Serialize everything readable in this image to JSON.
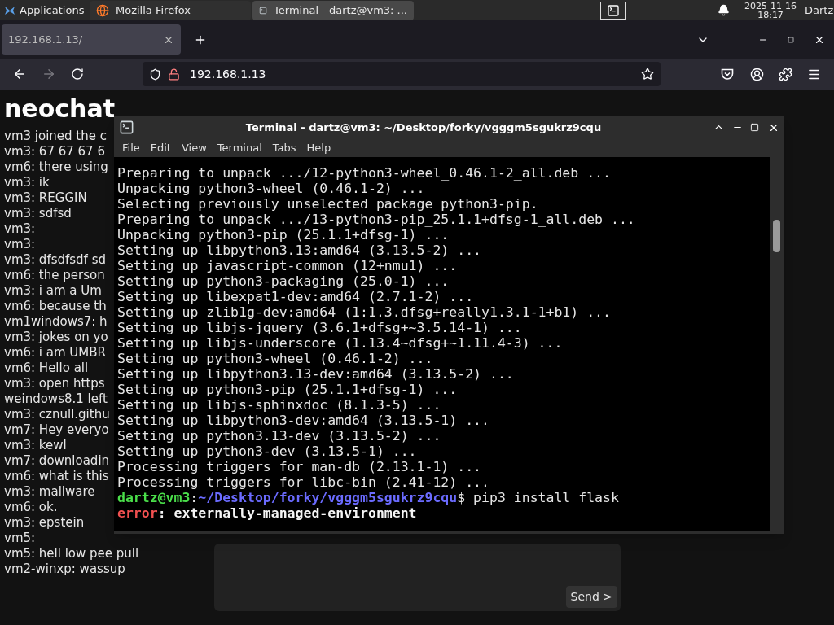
{
  "top_panel": {
    "menu_label": "Applications",
    "tasks": [
      {
        "label": "Mozilla Firefox",
        "kind": "browser",
        "selected": false
      },
      {
        "label": "Terminal - dartz@vm3: ...",
        "kind": "terminal",
        "selected": true
      }
    ],
    "date": "2025-11-16",
    "time": "18:17",
    "user": "Dartz"
  },
  "browser": {
    "tab": {
      "label": "192.168.1.13/"
    },
    "url": "192.168.1.13",
    "forward_disabled": true,
    "page": {
      "title": "neochat",
      "messages": [
        "vm3 joined the c",
        "vm3: 67 67 67 6",
        "vm6: there using",
        "vm3: ik",
        "vm3: REGGIN",
        "vm3: sdfsd",
        "vm3:",
        "vm3:",
        "vm3: dfsdfsdf sd",
        "vm6: the person",
        "vm3: i am a Um",
        "vm6: because th",
        "vm1windows7: h",
        "vm3: jokes on yo",
        "vm6: i am UMBR",
        "vm6: Hello all",
        "vm3: open https",
        "weindows8.1 left",
        "vm3: cznull.githu",
        "vm7: Hey everyo",
        "vm3: kewl",
        "vm7: downloadin",
        "vm6: what is this",
        "vm3: mallware",
        "vm6: ok.",
        "vm3: epstein",
        "vm5:",
        "vm5: hell low pee pull",
        "vm2-winxp: wassup"
      ],
      "send_button": "Send >"
    }
  },
  "terminal": {
    "title": "Terminal - dartz@vm3: ~/Desktop/forky/vgggm5sgukrz9cqu",
    "menu": [
      "File",
      "Edit",
      "View",
      "Terminal",
      "Tabs",
      "Help"
    ],
    "lines": [
      {
        "kind": "plain",
        "text": "Preparing to unpack .../12-python3-wheel_0.46.1-2_all.deb ..."
      },
      {
        "kind": "plain",
        "text": "Unpacking python3-wheel (0.46.1-2) ..."
      },
      {
        "kind": "plain",
        "text": "Selecting previously unselected package python3-pip."
      },
      {
        "kind": "plain",
        "text": "Preparing to unpack .../13-python3-pip_25.1.1+dfsg-1_all.deb ..."
      },
      {
        "kind": "plain",
        "text": "Unpacking python3-pip (25.1.1+dfsg-1) ..."
      },
      {
        "kind": "plain",
        "text": "Setting up libpython3.13:amd64 (3.13.5-2) ..."
      },
      {
        "kind": "plain",
        "text": "Setting up javascript-common (12+nmu1) ..."
      },
      {
        "kind": "plain",
        "text": "Setting up python3-packaging (25.0-1) ..."
      },
      {
        "kind": "plain",
        "text": "Setting up libexpat1-dev:amd64 (2.7.1-2) ..."
      },
      {
        "kind": "plain",
        "text": "Setting up zlib1g-dev:amd64 (1:1.3.dfsg+really1.3.1-1+b1) ..."
      },
      {
        "kind": "plain",
        "text": "Setting up libjs-jquery (3.6.1+dfsg+~3.5.14-1) ..."
      },
      {
        "kind": "plain",
        "text": "Setting up libjs-underscore (1.13.4~dfsg+~1.11.4-3) ..."
      },
      {
        "kind": "plain",
        "text": "Setting up python3-wheel (0.46.1-2) ..."
      },
      {
        "kind": "plain",
        "text": "Setting up libpython3.13-dev:amd64 (3.13.5-2) ..."
      },
      {
        "kind": "plain",
        "text": "Setting up python3-pip (25.1.1+dfsg-1) ..."
      },
      {
        "kind": "plain",
        "text": "Setting up libjs-sphinxdoc (8.1.3-5) ..."
      },
      {
        "kind": "plain",
        "text": "Setting up libpython3-dev:amd64 (3.13.5-1) ..."
      },
      {
        "kind": "plain",
        "text": "Setting up python3.13-dev (3.13.5-2) ..."
      },
      {
        "kind": "plain",
        "text": "Setting up python3-dev (3.13.5-1) ..."
      },
      {
        "kind": "plain",
        "text": "Processing triggers for man-db (2.13.1-1) ..."
      },
      {
        "kind": "plain",
        "text": "Processing triggers for libc-bin (2.41-12) ..."
      },
      {
        "kind": "prompt",
        "user": "dartz@vm3",
        "separator": ":",
        "path": "~/Desktop/forky/vgggm5sgukrz9cqu",
        "text": "$ pip3 install flask"
      },
      {
        "kind": "error",
        "label": "error",
        "text": ": externally-managed-environment"
      }
    ]
  }
}
